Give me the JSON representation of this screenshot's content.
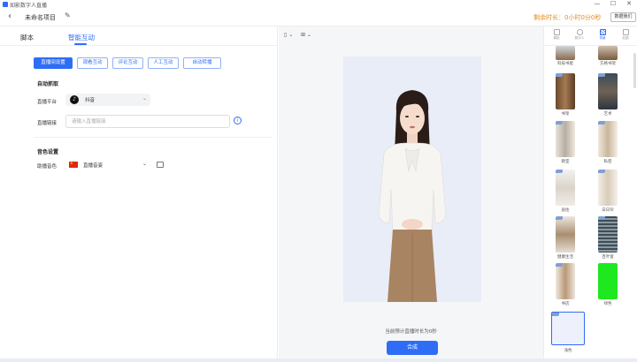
{
  "window": {
    "title": "如影数字人直播",
    "minimize": "—",
    "maximize": "☐",
    "close": "✕"
  },
  "header": {
    "back_icon": "‹",
    "project_name": "未命名项目",
    "edit_icon": "✎",
    "remaining_label": "剩余时长：",
    "remaining_value": "0小时0分0秒",
    "record_button": "数据我们"
  },
  "left": {
    "tabs": [
      {
        "label": "脚本",
        "active": false
      },
      {
        "label": "智能互动",
        "active": true
      }
    ],
    "subtabs": [
      {
        "label": "直播间设置",
        "active": true
      },
      {
        "label": "观看互动",
        "active": false
      },
      {
        "label": "评论互动",
        "active": false
      },
      {
        "label": "人工互动",
        "active": false
      },
      {
        "label": "自动转播",
        "active": false
      }
    ],
    "auto_capture": {
      "title": "自动抓取",
      "platform_label": "直播平台",
      "platform_value": "抖音",
      "link_label": "直播链接",
      "link_placeholder": "请输入直播链接",
      "link_value": ""
    },
    "voice": {
      "title": "音色设置",
      "voice_label": "助播音色",
      "voice_value": "直播音姿"
    }
  },
  "center": {
    "aspect_ctrl": "▯ ⌄",
    "ratio_ctrl": "⊞ ⌄",
    "duration_text": "当前预计直播时长为0秒",
    "compose_button": "合成"
  },
  "right": {
    "tabs": [
      {
        "label": "模板",
        "active": false
      },
      {
        "label": "数字人",
        "active": false
      },
      {
        "label": "背景",
        "active": true
      },
      {
        "label": "贴图",
        "active": false
      }
    ],
    "backgrounds": [
      {
        "label": "科技书屋"
      },
      {
        "label": "方格书架"
      },
      {
        "label": "书架"
      },
      {
        "label": "艺术"
      },
      {
        "label": "教室"
      },
      {
        "label": "私密"
      },
      {
        "label": "居住"
      },
      {
        "label": "白日帘"
      },
      {
        "label": "健康生活"
      },
      {
        "label": "百叶窗"
      },
      {
        "label": "书店"
      },
      {
        "label": "绿色"
      },
      {
        "label": "浅色"
      }
    ]
  },
  "colors": {
    "accent": "#2f6df6",
    "warning": "#e28a1c",
    "green_screen": "#1ee81e"
  }
}
